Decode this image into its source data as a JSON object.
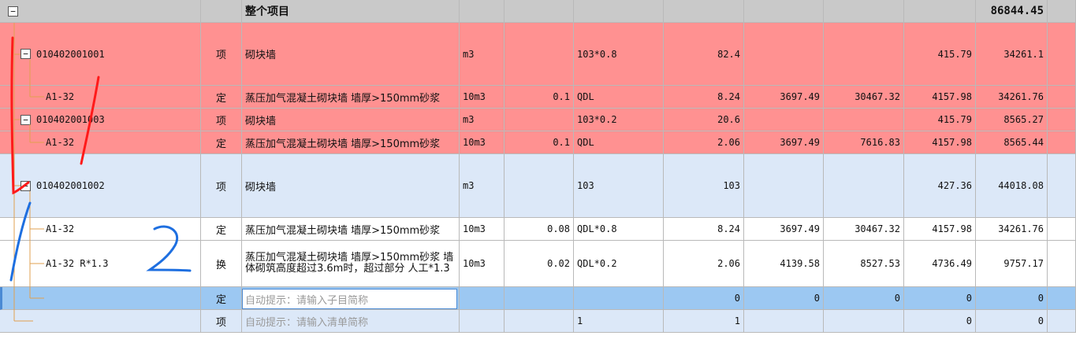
{
  "header": {
    "toggle": "−",
    "name": "整个项目",
    "total": "86844.45"
  },
  "rows": [
    {
      "code": "010402001001",
      "type": "项",
      "name": "砌块墙",
      "unit": "m3",
      "content": "",
      "qty_expr": "103*0.8",
      "qty": "82.4",
      "price": "",
      "amount": "",
      "unit_price": "415.79",
      "total": "34261.1"
    },
    {
      "code": "A1-32",
      "type": "定",
      "name": "蒸压加气混凝土砌块墙 墙厚>150mm砂浆",
      "unit": "10m3",
      "content": "0.1",
      "qty_expr": "QDL",
      "qty": "8.24",
      "price": "3697.49",
      "amount": "30467.32",
      "unit_price": "4157.98",
      "total": "34261.76"
    },
    {
      "code": "010402001003",
      "type": "项",
      "name": "砌块墙",
      "unit": "m3",
      "content": "",
      "qty_expr": "103*0.2",
      "qty": "20.6",
      "price": "",
      "amount": "",
      "unit_price": "415.79",
      "total": "8565.27"
    },
    {
      "code": "A1-32",
      "type": "定",
      "name": "蒸压加气混凝土砌块墙 墙厚>150mm砂浆",
      "unit": "10m3",
      "content": "0.1",
      "qty_expr": "QDL",
      "qty": "2.06",
      "price": "3697.49",
      "amount": "7616.83",
      "unit_price": "4157.98",
      "total": "8565.44"
    },
    {
      "code": "010402001002",
      "type": "项",
      "name": "砌块墙",
      "unit": "m3",
      "content": "",
      "qty_expr": "103",
      "qty": "103",
      "price": "",
      "amount": "",
      "unit_price": "427.36",
      "total": "44018.08"
    },
    {
      "code": "A1-32",
      "type": "定",
      "name": "蒸压加气混凝土砌块墙 墙厚>150mm砂浆",
      "unit": "10m3",
      "content": "0.08",
      "qty_expr": "QDL*0.8",
      "qty": "8.24",
      "price": "3697.49",
      "amount": "30467.32",
      "unit_price": "4157.98",
      "total": "34261.76"
    },
    {
      "code": "A1-32 R*1.3",
      "type": "换",
      "name": "蒸压加气混凝土砌块墙 墙厚>150mm砂浆 墙体砌筑高度超过3.6m时，超过部分 人工*1.3",
      "unit": "10m3",
      "content": "0.02",
      "qty_expr": "QDL*0.2",
      "qty": "2.06",
      "price": "4139.58",
      "amount": "8527.53",
      "unit_price": "4736.49",
      "total": "9757.17"
    },
    {
      "code": "",
      "type": "定",
      "name": "",
      "placeholder": "自动提示：请输入子目简称",
      "unit": "",
      "content": "",
      "qty_expr": "",
      "qty": "0",
      "price": "0",
      "amount": "0",
      "unit_price": "0",
      "total": "0"
    },
    {
      "code": "",
      "type": "项",
      "name": "",
      "placeholder": "自动提示：请输入清单简称",
      "unit": "",
      "content": "",
      "qty_expr": "1",
      "qty": "1",
      "price": "",
      "amount": "",
      "unit_price": "0",
      "total": "0"
    }
  ],
  "toggle_symbol": "−",
  "annotations": {
    "mark1": "1",
    "mark2": "2"
  },
  "colors": {
    "red_row": "#ff9191",
    "blue_row": "#dce8f8",
    "selected_row": "#9cc8f2",
    "header": "#c9c9c9",
    "annotation_red": "#ff1a1a",
    "annotation_blue": "#1e6fe0"
  }
}
